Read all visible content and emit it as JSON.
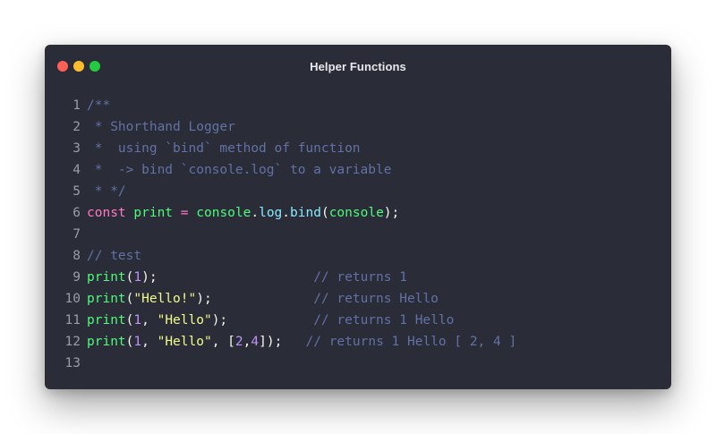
{
  "window": {
    "title": "Helper Functions",
    "traffic_lights": [
      {
        "name": "close",
        "color": "#ff5f56"
      },
      {
        "name": "minimize",
        "color": "#ffbd2e"
      },
      {
        "name": "zoom",
        "color": "#27c93f"
      }
    ]
  },
  "theme": {
    "background": "#2a2c37",
    "comment": "#6272a4",
    "keyword": "#ff79c6",
    "function": "#50fa7b",
    "property": "#8be9fd",
    "number": "#bd93f9",
    "string": "#f1fa8c",
    "plain": "#f8f8f2",
    "line_number": "#9a9cab"
  },
  "code": {
    "lines": [
      {
        "n": "1",
        "tokens": [
          {
            "t": "/**",
            "k": "comment"
          }
        ]
      },
      {
        "n": "2",
        "tokens": [
          {
            "t": " * Shorthand Logger",
            "k": "comment"
          }
        ]
      },
      {
        "n": "3",
        "tokens": [
          {
            "t": " *  using `bind` method of function",
            "k": "comment"
          }
        ]
      },
      {
        "n": "4",
        "tokens": [
          {
            "t": " *  -> bind `console.log` to a variable",
            "k": "comment"
          }
        ]
      },
      {
        "n": "5",
        "tokens": [
          {
            "t": " * */",
            "k": "comment"
          }
        ]
      },
      {
        "n": "6",
        "tokens": [
          {
            "t": "const",
            "k": "keyword"
          },
          {
            "t": " ",
            "k": "plain"
          },
          {
            "t": "print",
            "k": "func"
          },
          {
            "t": " ",
            "k": "plain"
          },
          {
            "t": "=",
            "k": "op"
          },
          {
            "t": " ",
            "k": "plain"
          },
          {
            "t": "console",
            "k": "func"
          },
          {
            "t": ".",
            "k": "plain"
          },
          {
            "t": "log",
            "k": "prop"
          },
          {
            "t": ".",
            "k": "plain"
          },
          {
            "t": "bind",
            "k": "prop"
          },
          {
            "t": "(",
            "k": "plain"
          },
          {
            "t": "console",
            "k": "func"
          },
          {
            "t": ");",
            "k": "plain"
          }
        ]
      },
      {
        "n": "7",
        "tokens": []
      },
      {
        "n": "8",
        "tokens": [
          {
            "t": "// test",
            "k": "comment"
          }
        ]
      },
      {
        "n": "9",
        "tokens": [
          {
            "t": "print",
            "k": "func"
          },
          {
            "t": "(",
            "k": "plain"
          },
          {
            "t": "1",
            "k": "number"
          },
          {
            "t": ");                    ",
            "k": "plain"
          },
          {
            "t": "// returns 1",
            "k": "comment"
          }
        ]
      },
      {
        "n": "10",
        "tokens": [
          {
            "t": "print",
            "k": "func"
          },
          {
            "t": "(",
            "k": "plain"
          },
          {
            "t": "\"Hello!\"",
            "k": "string"
          },
          {
            "t": ");             ",
            "k": "plain"
          },
          {
            "t": "// returns Hello",
            "k": "comment"
          }
        ]
      },
      {
        "n": "11",
        "tokens": [
          {
            "t": "print",
            "k": "func"
          },
          {
            "t": "(",
            "k": "plain"
          },
          {
            "t": "1",
            "k": "number"
          },
          {
            "t": ", ",
            "k": "plain"
          },
          {
            "t": "\"Hello\"",
            "k": "string"
          },
          {
            "t": ");           ",
            "k": "plain"
          },
          {
            "t": "// returns 1 Hello",
            "k": "comment"
          }
        ]
      },
      {
        "n": "12",
        "tokens": [
          {
            "t": "print",
            "k": "func"
          },
          {
            "t": "(",
            "k": "plain"
          },
          {
            "t": "1",
            "k": "number"
          },
          {
            "t": ", ",
            "k": "plain"
          },
          {
            "t": "\"Hello\"",
            "k": "string"
          },
          {
            "t": ", [",
            "k": "plain"
          },
          {
            "t": "2",
            "k": "number"
          },
          {
            "t": ",",
            "k": "plain"
          },
          {
            "t": "4",
            "k": "number"
          },
          {
            "t": "]);   ",
            "k": "plain"
          },
          {
            "t": "// returns 1 Hello [ 2, 4 ]",
            "k": "comment"
          }
        ]
      },
      {
        "n": "13",
        "tokens": []
      }
    ]
  }
}
